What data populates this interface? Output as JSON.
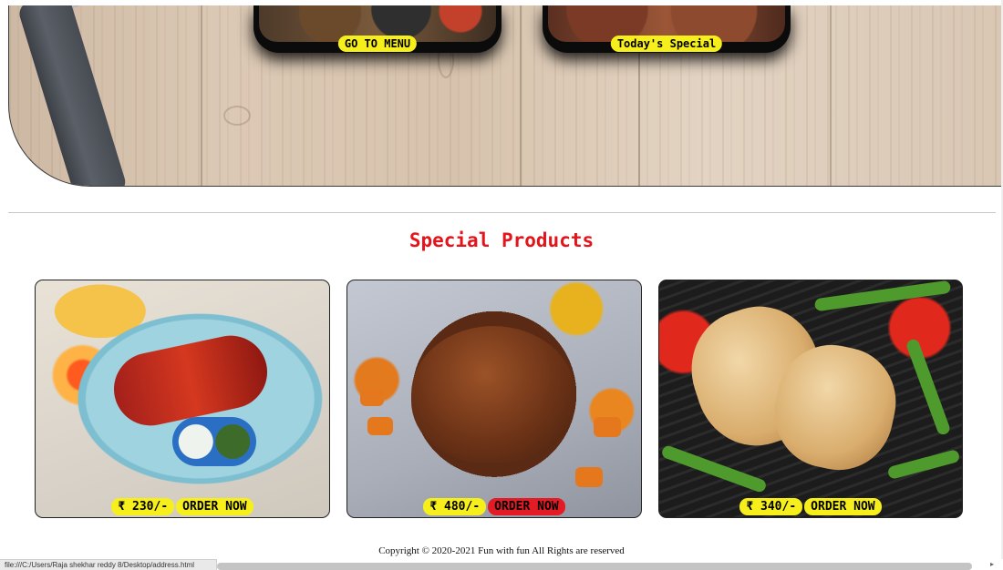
{
  "hero": {
    "cards": [
      {
        "id": "menu",
        "label": "GO TO MENU"
      },
      {
        "id": "special",
        "label": "Today's Special"
      }
    ]
  },
  "section": {
    "title": "Special Products"
  },
  "products": [
    {
      "price": "₹ 230/-",
      "order_label": "ORDER NOW",
      "order_color": "#f6ef1c"
    },
    {
      "price": "₹ 480/-",
      "order_label": "ORDER NOW",
      "order_color": "#e31b24"
    },
    {
      "price": "₹ 340/-",
      "order_label": "ORDER NOW",
      "order_color": "#f6ef1c"
    }
  ],
  "footer": {
    "copyright": "Copyright © 2020-2021 Fun with fun All Rights are reserved"
  },
  "browser": {
    "status_url": "file:///C:/Users/Raja shekhar reddy 8/Desktop/address.html"
  },
  "colors": {
    "accent_yellow": "#f6ef1c",
    "title_red": "#e3141b",
    "highlight_red": "#e31b24"
  }
}
